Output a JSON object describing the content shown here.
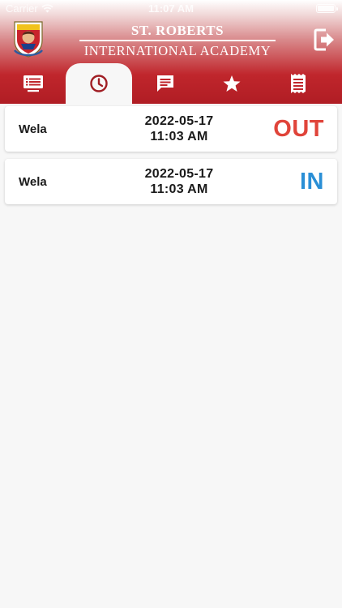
{
  "status_bar": {
    "carrier": "Carrier",
    "time": "11:07 AM"
  },
  "header": {
    "school_name_line1": "ST. ROBERTS",
    "school_name_line2": "INTERNATIONAL ACADEMY",
    "logout_icon": "logout-icon",
    "crest_icon": "school-crest"
  },
  "tabs": [
    {
      "icon": "dashboard-list-icon",
      "active": false
    },
    {
      "icon": "clock-icon",
      "active": true
    },
    {
      "icon": "message-icon",
      "active": false
    },
    {
      "icon": "star-icon",
      "active": false
    },
    {
      "icon": "receipt-icon",
      "active": false
    }
  ],
  "attendance": [
    {
      "name": "Wela",
      "date": "2022-05-17",
      "time": "11:03 AM",
      "status": "OUT",
      "status_color": "#e0443a"
    },
    {
      "name": "Wela",
      "date": "2022-05-17",
      "time": "11:03 AM",
      "status": "IN",
      "status_color": "#2a8fd6"
    }
  ],
  "colors": {
    "header_red": "#b01d24",
    "active_tab_icon": "#a01e24",
    "background": "#f7f7f7"
  }
}
